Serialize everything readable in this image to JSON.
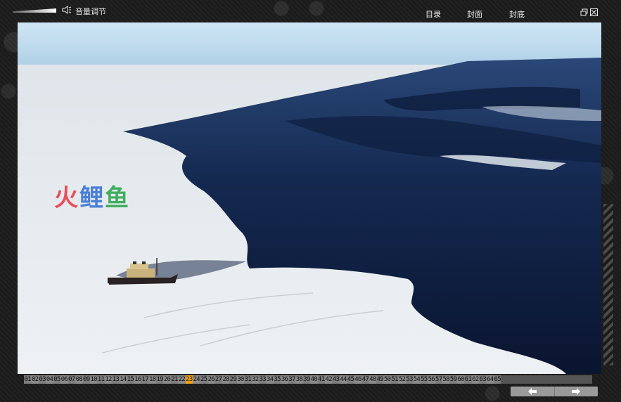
{
  "topbar": {
    "volume_label": "音量调节",
    "nav": {
      "toc": "目录",
      "cover": "封面",
      "back_cover": "封底"
    }
  },
  "photo": {
    "watermark": [
      "火",
      "鲤",
      "鱼"
    ]
  },
  "pages": {
    "items": [
      "01",
      "02",
      "03",
      "04",
      "05",
      "06",
      "07",
      "08",
      "09",
      "10",
      "11",
      "12",
      "13",
      "14",
      "15",
      "16",
      "17",
      "18",
      "19",
      "20",
      "21",
      "22",
      "23",
      "24",
      "25",
      "26",
      "27",
      "28",
      "29",
      "30",
      "31",
      "32",
      "33",
      "34",
      "35",
      "36",
      "37",
      "38",
      "39",
      "40",
      "41",
      "42",
      "43",
      "44",
      "45",
      "46",
      "47",
      "48",
      "49",
      "50",
      "51",
      "52",
      "53",
      "54",
      "55",
      "56",
      "57",
      "58",
      "59",
      "60",
      "61",
      "62",
      "63",
      "64",
      "65"
    ],
    "current": "23"
  },
  "colors": {
    "frame_bg": "#1a1a1a",
    "current_page": "#f0a010",
    "sea_dark": "#0d1a3a",
    "ice": "#e8ecf0"
  }
}
